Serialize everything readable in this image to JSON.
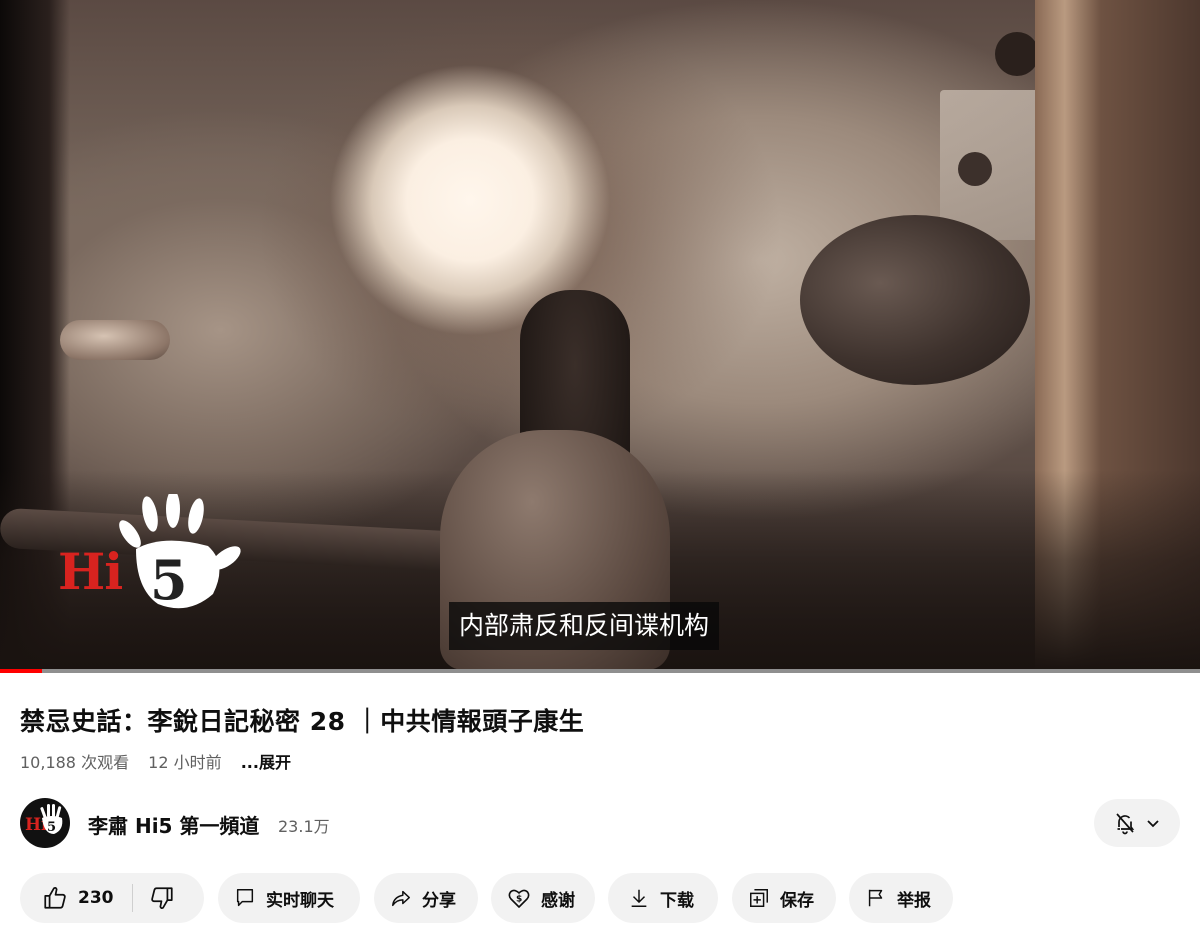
{
  "video": {
    "subtitle": "内部肃反和反间谍机构",
    "watermark": "Hi5",
    "progress_fraction": 0.035,
    "progress_color": "#ff0000"
  },
  "title": "禁忌史話：李銳日記秘密 28 ｜中共情報頭子康生",
  "meta": {
    "views": "10,188 次观看",
    "time": "12 小时前",
    "more": "...展开"
  },
  "channel": {
    "name": "李肅 Hi5 第一頻道",
    "subscribers": "23.1万",
    "avatar_text": "Hi5",
    "bell_icon": "bell-off-icon"
  },
  "actions": {
    "like_count": "230",
    "like_icon": "thumbs-up-icon",
    "dislike_icon": "thumbs-down-icon",
    "chat_label": "实时聊天",
    "share_label": "分享",
    "thanks_label": "感谢",
    "download_label": "下载",
    "save_label": "保存",
    "report_label": "举报"
  },
  "colors": {
    "brand_red": "#d8231f",
    "pill_bg": "#f2f2f2",
    "secondary_text": "#606060"
  }
}
